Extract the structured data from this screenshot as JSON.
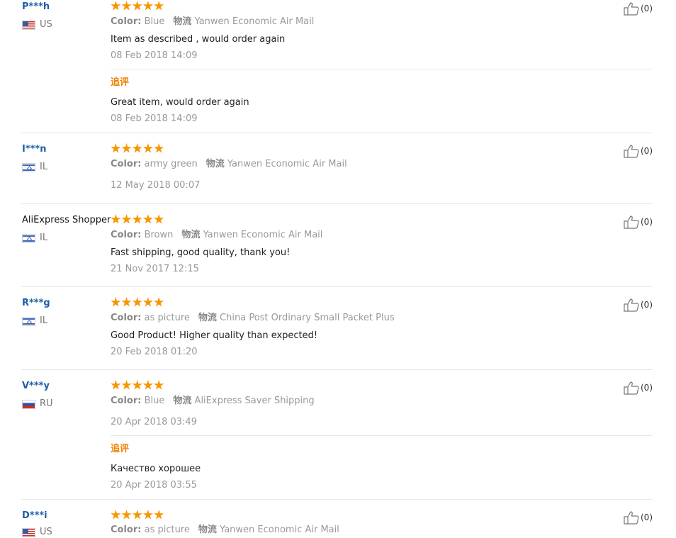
{
  "labels": {
    "color": "Color:",
    "logistics": "物流",
    "additional": "追评"
  },
  "colors": {
    "star": "#f79600",
    "name": "#1f5fa8",
    "additional": "#f08200"
  },
  "reviews": [
    {
      "name": "P***h",
      "country": "US",
      "flag": "us-flag-icon",
      "rating": 5,
      "color": "Blue",
      "shipping": "Yanwen Economic Air Mail",
      "text": "Item as described , would order again",
      "date": "08 Feb 2018 14:09",
      "likes": "(0)",
      "additional": {
        "text": "Great item, would order again",
        "date": "08 Feb 2018 14:09"
      }
    },
    {
      "name": "I***n",
      "country": "IL",
      "flag": "il-flag-icon",
      "rating": 5,
      "color": "army green",
      "shipping": "Yanwen Economic Air Mail",
      "text": "",
      "date": "12 May 2018 00:07",
      "likes": "(0)"
    },
    {
      "name": "AliExpress Shopper",
      "country": "IL",
      "flag": "il-flag-icon",
      "rating": 5,
      "color": "Brown",
      "shipping": "Yanwen Economic Air Mail",
      "text": "Fast shipping, good quality, thank you!",
      "date": "21 Nov 2017 12:15",
      "likes": "(0)"
    },
    {
      "name": "R***g",
      "country": "IL",
      "flag": "il-flag-icon",
      "rating": 5,
      "color": "as picture",
      "shipping": "China Post Ordinary Small Packet Plus",
      "text": "Good Product! Higher quality than expected!",
      "date": "20 Feb 2018 01:20",
      "likes": "(0)"
    },
    {
      "name": "V***y",
      "country": "RU",
      "flag": "ru-flag-icon",
      "rating": 5,
      "color": "Blue",
      "shipping": "AliExpress Saver Shipping",
      "text": "",
      "date": "20 Apr 2018 03:49",
      "likes": "(0)",
      "additional": {
        "text": "Качество хорошее",
        "date": "20 Apr 2018 03:55"
      }
    },
    {
      "name": "D***i",
      "country": "US",
      "flag": "us-flag-icon",
      "rating": 5,
      "color": "as picture",
      "shipping": "Yanwen Economic Air Mail",
      "text": "",
      "date": "",
      "likes": "(0)"
    }
  ]
}
